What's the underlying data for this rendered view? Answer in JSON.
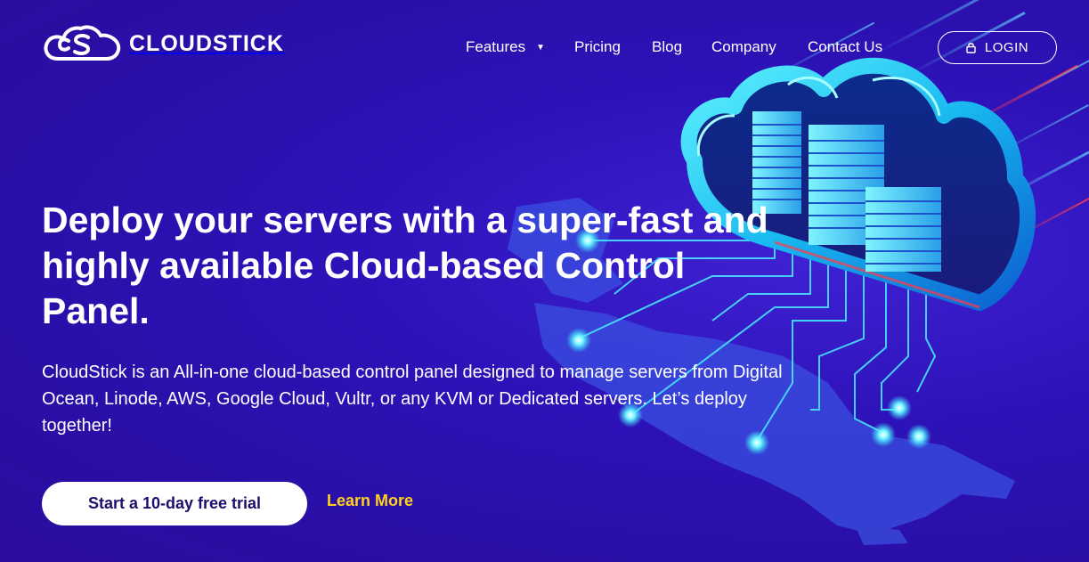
{
  "brand": {
    "name": "CLOUDSTICK",
    "logo_icon": "cloud-cs-logo-icon"
  },
  "nav": {
    "features": "Features",
    "pricing": "Pricing",
    "blog": "Blog",
    "company": "Company",
    "contact": "Contact Us",
    "login": "LOGIN"
  },
  "hero": {
    "headline": "Deploy your servers with a super-fast and highly available Cloud-based Control Panel.",
    "lede": "CloudStick is an All-in-one cloud-based control panel designed to manage servers from Digital Ocean, Linode, AWS, Google Cloud, Vultr, or any KVM or Dedicated servers. Let’s deploy together!",
    "cta_label": "Start a 10-day free trial",
    "learn_more": "Learn More"
  },
  "colors": {
    "background": "#2d12b8",
    "accent_yellow": "#ffd21f",
    "cta_text": "#1c0e6b",
    "glow_cyan": "#29e6ff"
  }
}
